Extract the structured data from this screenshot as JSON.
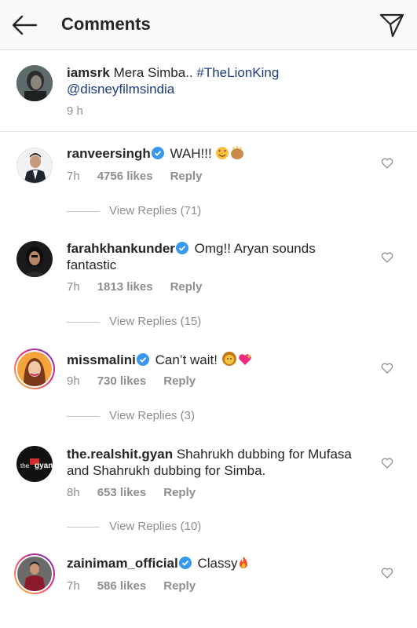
{
  "header": {
    "title": "Comments"
  },
  "caption": {
    "username": "iamsrk",
    "text": "Mera Simba..",
    "hashtag": "#TheLionKing",
    "mention": "@disneyfilmsindia",
    "time": "9 h"
  },
  "comments": [
    {
      "username": "ranveersingh",
      "text_line1": "WAH!!!",
      "text_line2": "",
      "time": "7h",
      "likes": "4756 likes",
      "reply": "Reply",
      "view_replies": "View Replies (71)"
    },
    {
      "username": "farahkhankunder",
      "text_line1": "Omg!! Aryan sounds",
      "text_line2": "fantastic",
      "time": "7h",
      "likes": "1813 likes",
      "reply": "Reply",
      "view_replies": "View Replies (15)"
    },
    {
      "username": "missmalini",
      "text_line1": "Can’t wait!",
      "text_line2": "",
      "time": "9h",
      "likes": "730 likes",
      "reply": "Reply",
      "view_replies": "View Replies (3)"
    },
    {
      "username": "the.realshit.gyan",
      "text_line1": "Shahrukh dubbing for Mufasa",
      "text_line2": "and Shahrukh dubbing for Simba.",
      "time": "8h",
      "likes": "653 likes",
      "reply": "Reply",
      "view_replies": "View Replies (10)"
    },
    {
      "username": "zainimam_official",
      "text_line1": "Classy",
      "text_line2": "",
      "time": "7h",
      "likes": "586 likes",
      "reply": "Reply",
      "view_replies": ""
    }
  ],
  "avatar_text": {
    "realshit": "the",
    "realshit_sub": "gyan"
  },
  "colors": {
    "verified": "#3897f0",
    "link": "#1c3d7a",
    "muted": "#8e8e8e"
  }
}
